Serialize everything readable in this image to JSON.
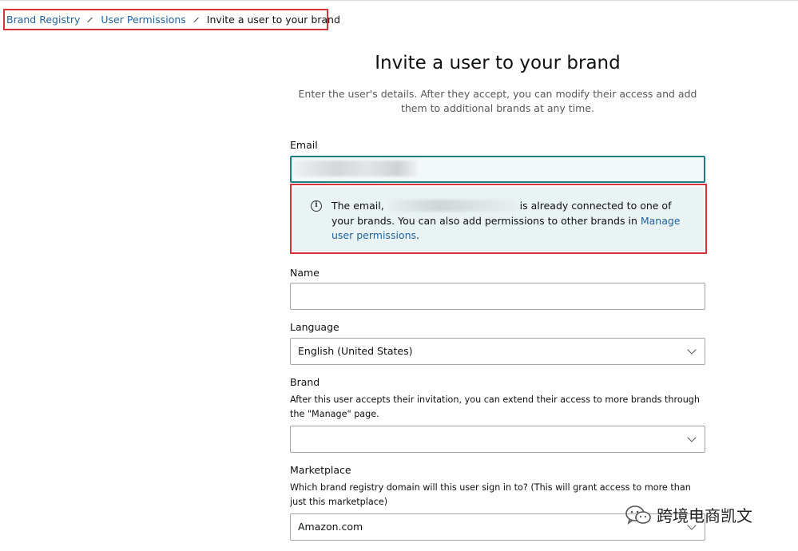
{
  "breadcrumb": {
    "items": [
      "Brand Registry",
      "User Permissions"
    ],
    "current": "Invite a user to your brand"
  },
  "header": {
    "title": "Invite a user to your brand",
    "subtitle": "Enter the user's details. After they accept, you can modify their access and add them to additional brands at any time."
  },
  "form": {
    "email": {
      "label": "Email",
      "value": ""
    },
    "alert": {
      "text_before": "The email,",
      "text_after": "is already connected to one of your brands. You can also add permissions to other brands in",
      "link": "Manage user permissions",
      "text_end": "."
    },
    "name": {
      "label": "Name",
      "value": ""
    },
    "language": {
      "label": "Language",
      "value": "English (United States)"
    },
    "brand": {
      "label": "Brand",
      "help": "After this user accepts their invitation, you can extend their access to more brands through the \"Manage\" page.",
      "value": ""
    },
    "marketplace": {
      "label": "Marketplace",
      "help": "Which brand registry domain will this user sign in to? (This will grant access to more than just this marketplace)",
      "value": "Amazon.com"
    }
  },
  "watermark": {
    "text": "跨境电商凯文",
    "icon": "wechat-icon"
  },
  "colors": {
    "highlight_border": "#d6343a",
    "link": "#2162a1",
    "focus_border": "#1b7f86",
    "alert_bg": "#eaf3f3"
  }
}
